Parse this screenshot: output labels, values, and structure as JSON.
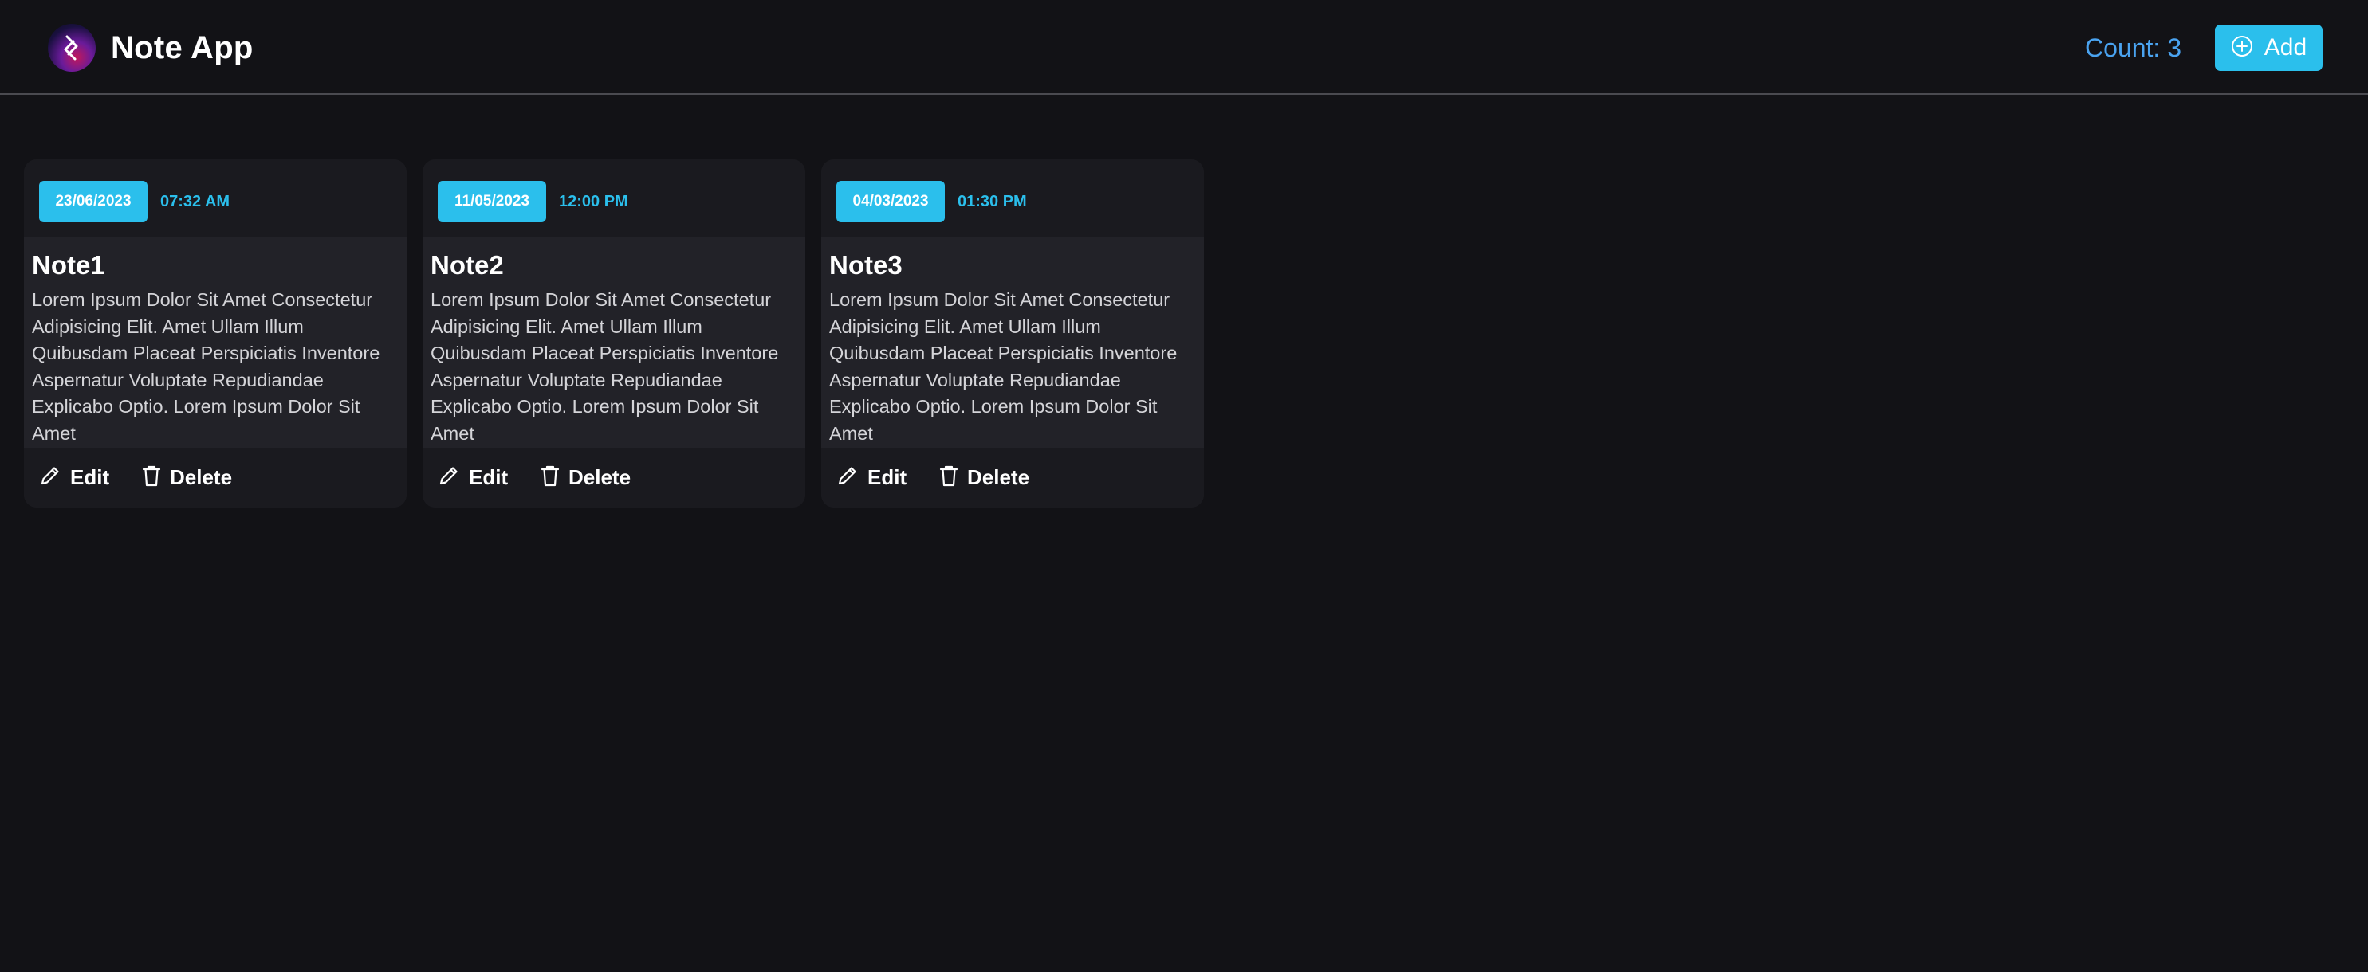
{
  "header": {
    "app_title": "Note App",
    "count_label": "Count: 3",
    "add_label": "Add"
  },
  "notes": [
    {
      "title": "Note1",
      "date": "23/06/2023",
      "time": "07:32 AM",
      "body": "Lorem Ipsum Dolor Sit Amet Consectetur Adipisicing Elit. Amet Ullam Illum Quibusdam Placeat Perspiciatis Inventore Aspernatur Voluptate Repudiandae Explicabo Optio. Lorem Ipsum Dolor Sit Amet",
      "edit_label": "Edit",
      "delete_label": "Delete"
    },
    {
      "title": "Note2",
      "date": "11/05/2023",
      "time": "12:00 PM",
      "body": "Lorem Ipsum Dolor Sit Amet Consectetur Adipisicing Elit. Amet Ullam Illum Quibusdam Placeat Perspiciatis Inventore Aspernatur Voluptate Repudiandae Explicabo Optio. Lorem Ipsum Dolor Sit Amet",
      "edit_label": "Edit",
      "delete_label": "Delete"
    },
    {
      "title": "Note3",
      "date": "04/03/2023",
      "time": "01:30 PM",
      "body": "Lorem Ipsum Dolor Sit Amet Consectetur Adipisicing Elit. Amet Ullam Illum Quibusdam Placeat Perspiciatis Inventore Aspernatur Voluptate Repudiandae Explicabo Optio. Lorem Ipsum Dolor Sit Amet",
      "edit_label": "Edit",
      "delete_label": "Delete"
    }
  ],
  "icons": {
    "logo": "app-logo",
    "add": "plus-circle-icon",
    "edit": "pencil-icon",
    "delete": "trash-icon"
  },
  "colors": {
    "background": "#121216",
    "accent": "#2bbfec",
    "count_text": "#4aa3f0",
    "card": "#1d1d22"
  }
}
